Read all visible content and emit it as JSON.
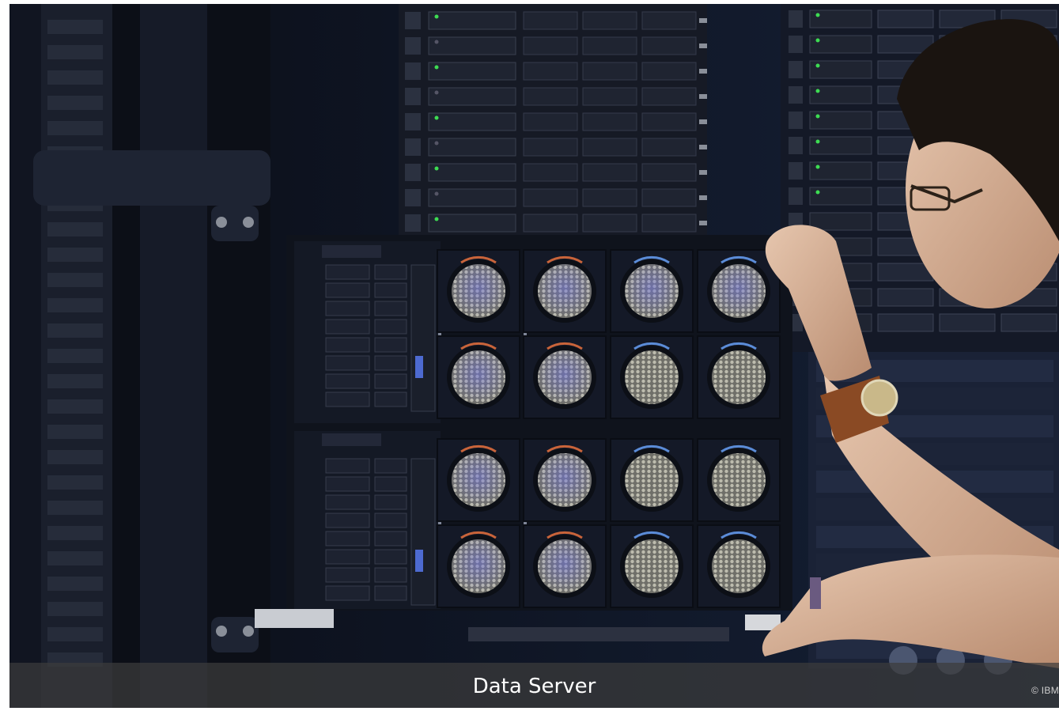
{
  "figure": {
    "caption": "Data Server",
    "credit": "© IBM",
    "image_icon": "server-rack-photo",
    "colors": {
      "caption_bar": "#3c3c3c",
      "caption_text": "#ffffff",
      "rack_dark": "#0d1220",
      "fan_mesh": "#9a9a8e",
      "led_green": "#3ddc52"
    }
  }
}
